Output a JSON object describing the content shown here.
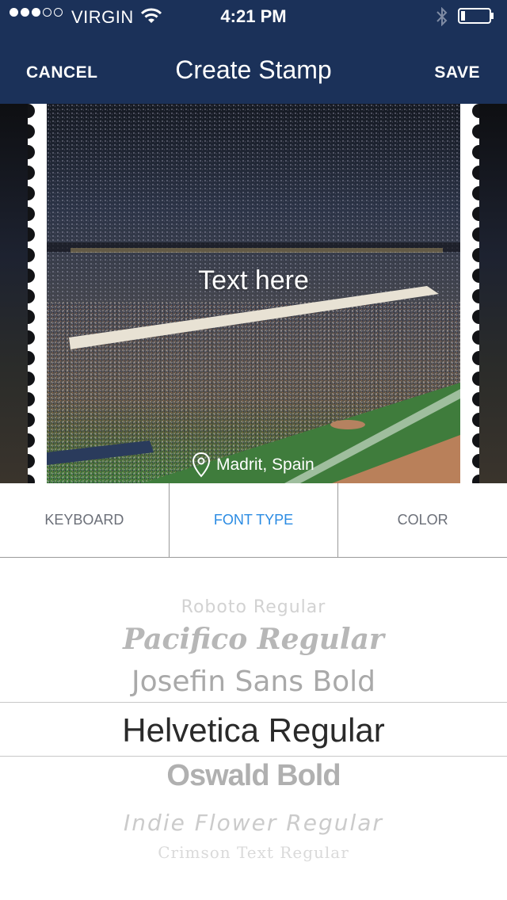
{
  "status_bar": {
    "carrier": "VIRGIN",
    "time": "4:21 PM",
    "signal_filled": 3,
    "signal_total": 5
  },
  "nav": {
    "cancel_label": "CANCEL",
    "title": "Create Stamp",
    "save_label": "SAVE"
  },
  "stamp": {
    "text": "Text here",
    "location": "Madrit, Spain"
  },
  "tabs": [
    {
      "label": "KEYBOARD",
      "active": false
    },
    {
      "label": "FONT TYPE",
      "active": true
    },
    {
      "label": "COLOR",
      "active": false
    }
  ],
  "fonts": {
    "selected": "Helvetica Regular",
    "options": [
      "Roboto Regular",
      "Pacifico Regular",
      "Josefin Sans Bold",
      "Helvetica Regular",
      "Oswald Bold",
      "Indie Flower Regular",
      "Crimson Text Regular"
    ]
  },
  "colors": {
    "nav_background": "#1b3159",
    "active_tab": "#2a8be3",
    "inactive_tab": "#6b6f78"
  }
}
